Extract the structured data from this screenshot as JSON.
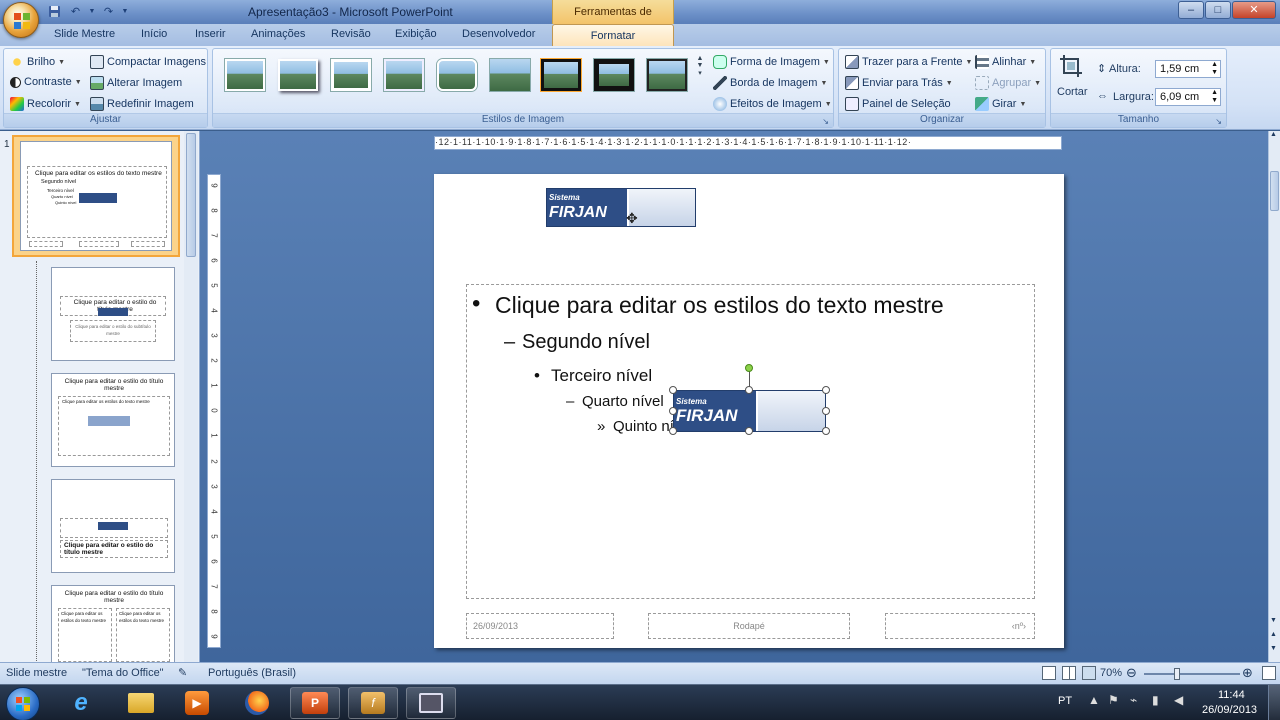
{
  "titlebar": {
    "document_title": "Apresentação3 - Microsoft PowerPoint",
    "tools_tab": "Ferramentas de Imagem",
    "min_label": "–",
    "max_label": "□",
    "close_label": "✕"
  },
  "tabs": {
    "slide_mestre": "Slide Mestre",
    "inicio": "Início",
    "inserir": "Inserir",
    "animacoes": "Animações",
    "revisao": "Revisão",
    "exibicao": "Exibição",
    "desenvolvedor": "Desenvolvedor",
    "formatar": "Formatar"
  },
  "ribbon": {
    "ajustar": {
      "label": "Ajustar",
      "brilho": "Brilho",
      "contraste": "Contraste",
      "recolorir": "Recolorir",
      "compactar": "Compactar Imagens",
      "alterar": "Alterar Imagem",
      "redefinir": "Redefinir Imagem"
    },
    "estilos": {
      "label": "Estilos de Imagem",
      "forma": "Forma de Imagem",
      "borda": "Borda de Imagem",
      "efeitos": "Efeitos de Imagem"
    },
    "organizar": {
      "label": "Organizar",
      "trazer": "Trazer para a Frente",
      "enviar": "Enviar para Trás",
      "painel": "Painel de Seleção",
      "alinhar": "Alinhar",
      "agrupar": "Agrupar",
      "girar": "Girar"
    },
    "tamanho": {
      "label": "Tamanho",
      "cortar": "Cortar",
      "altura_label": "Altura:",
      "altura_value": "1,59 cm",
      "largura_label": "Largura:",
      "largura_value": "6,09 cm"
    }
  },
  "thumbnails": {
    "slide_number": "1",
    "master_title": "Clique para editar os estilos do texto mestre",
    "master_l2": "Segundo nível",
    "master_l3": "Terceiro nível",
    "master_l4": "Quarto nível",
    "master_l5": "Quinto nível",
    "layout2_title": "Clique para editar o estilo do título mestre",
    "layout2_sub": "Clique para editar o estilo do subtítulo mestre",
    "layout3_title": "Clique para editar o estilo do título mestre",
    "layout3_body": "Clique para editar os estilos do texto mestre",
    "layout4_title": "Clique para editar o estilo do título mestre",
    "layout5_title": "Clique para editar o estilo do título mestre",
    "layout5_body": "Clique para editar os estilos do texto mestre"
  },
  "ruler": {
    "horizontal": "·12·1·11·1·10·1·9·1·8·1·7·1·6·1·5·1·4·1·3·1·2·1·1·1·0·1·1·1·2·1·3·1·4·1·5·1·6·1·7·1·8·1·9·1·10·1·11·1·12·",
    "vertical": [
      "9",
      "8",
      "7",
      "6",
      "5",
      "4",
      "3",
      "2",
      "1",
      "0",
      "1",
      "2",
      "3",
      "4",
      "5",
      "6",
      "7",
      "8",
      "9"
    ]
  },
  "slide": {
    "logo_top": "Sistema",
    "logo_main": "FIRJAN",
    "level1": "Clique para editar os estilos do texto mestre",
    "level2": "Segundo nível",
    "level3": "Terceiro nível",
    "level4": "Quarto nível",
    "level5": "Quinto nível",
    "bullet1": "•",
    "bullet2": "–",
    "bullet3": "•",
    "bullet4": "–",
    "bullet5": "»",
    "footer_date": "26/09/2013",
    "footer_mid": "Rodapé",
    "footer_num": "‹nº›"
  },
  "statusbar": {
    "view": "Slide mestre",
    "theme": "\"Tema do Office\"",
    "language": "Português (Brasil)",
    "zoom": "70%"
  },
  "taskbar": {
    "lang": "PT",
    "time": "11:44",
    "date": "26/09/2013"
  },
  "colors": {
    "accent": "#f3a63b",
    "ribbon_blue": "#d4e2f6",
    "firjan_blue": "#2e4e86"
  }
}
